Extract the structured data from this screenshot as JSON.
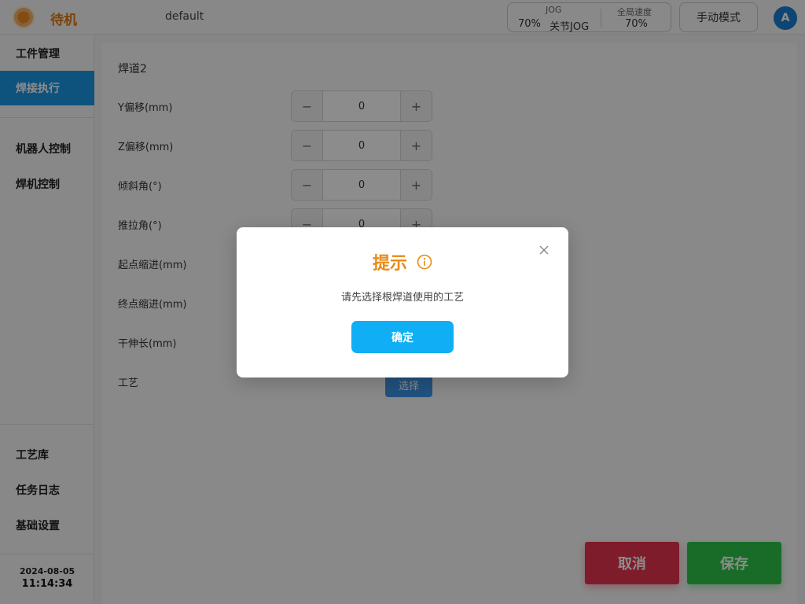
{
  "header": {
    "status": "待机",
    "profile": "default",
    "jog": {
      "label": "JOG",
      "value": "70%",
      "mode": "关节JOG",
      "speed_label": "全局速度",
      "speed_value": "70%"
    },
    "mode_button": "手动模式",
    "avatar_letter": "A"
  },
  "sidebar": {
    "items": [
      {
        "label": "工件管理"
      },
      {
        "label": "焊接执行"
      },
      {
        "label": "机器人控制"
      },
      {
        "label": "焊机控制"
      },
      {
        "label": "工艺库"
      },
      {
        "label": "任务日志"
      },
      {
        "label": "基础设置"
      }
    ],
    "date": "2024-08-05",
    "time": "11:14:34"
  },
  "main": {
    "title": "焊道2",
    "fields": [
      {
        "label": "Y偏移(mm)",
        "value": "0"
      },
      {
        "label": "Z偏移(mm)",
        "value": "0"
      },
      {
        "label": "倾斜角(°)",
        "value": "0"
      },
      {
        "label": "推拉角(°)",
        "value": "0"
      },
      {
        "label": "起点缩进(mm)"
      },
      {
        "label": "终点缩进(mm)"
      },
      {
        "label": "干伸长(mm)"
      },
      {
        "label": "工艺"
      }
    ],
    "select_button": "选择",
    "cancel_button": "取消",
    "save_button": "保存",
    "stepper_minus": "−",
    "stepper_plus": "+"
  },
  "modal": {
    "title": "提示",
    "message": "请先选择根焊道使用的工艺",
    "confirm_button": "确定"
  },
  "colors": {
    "accent": "#1a96e6",
    "status_orange": "#e07b12",
    "cancel": "#e8344f",
    "save": "#2fc54a",
    "confirm": "#10aef5"
  }
}
